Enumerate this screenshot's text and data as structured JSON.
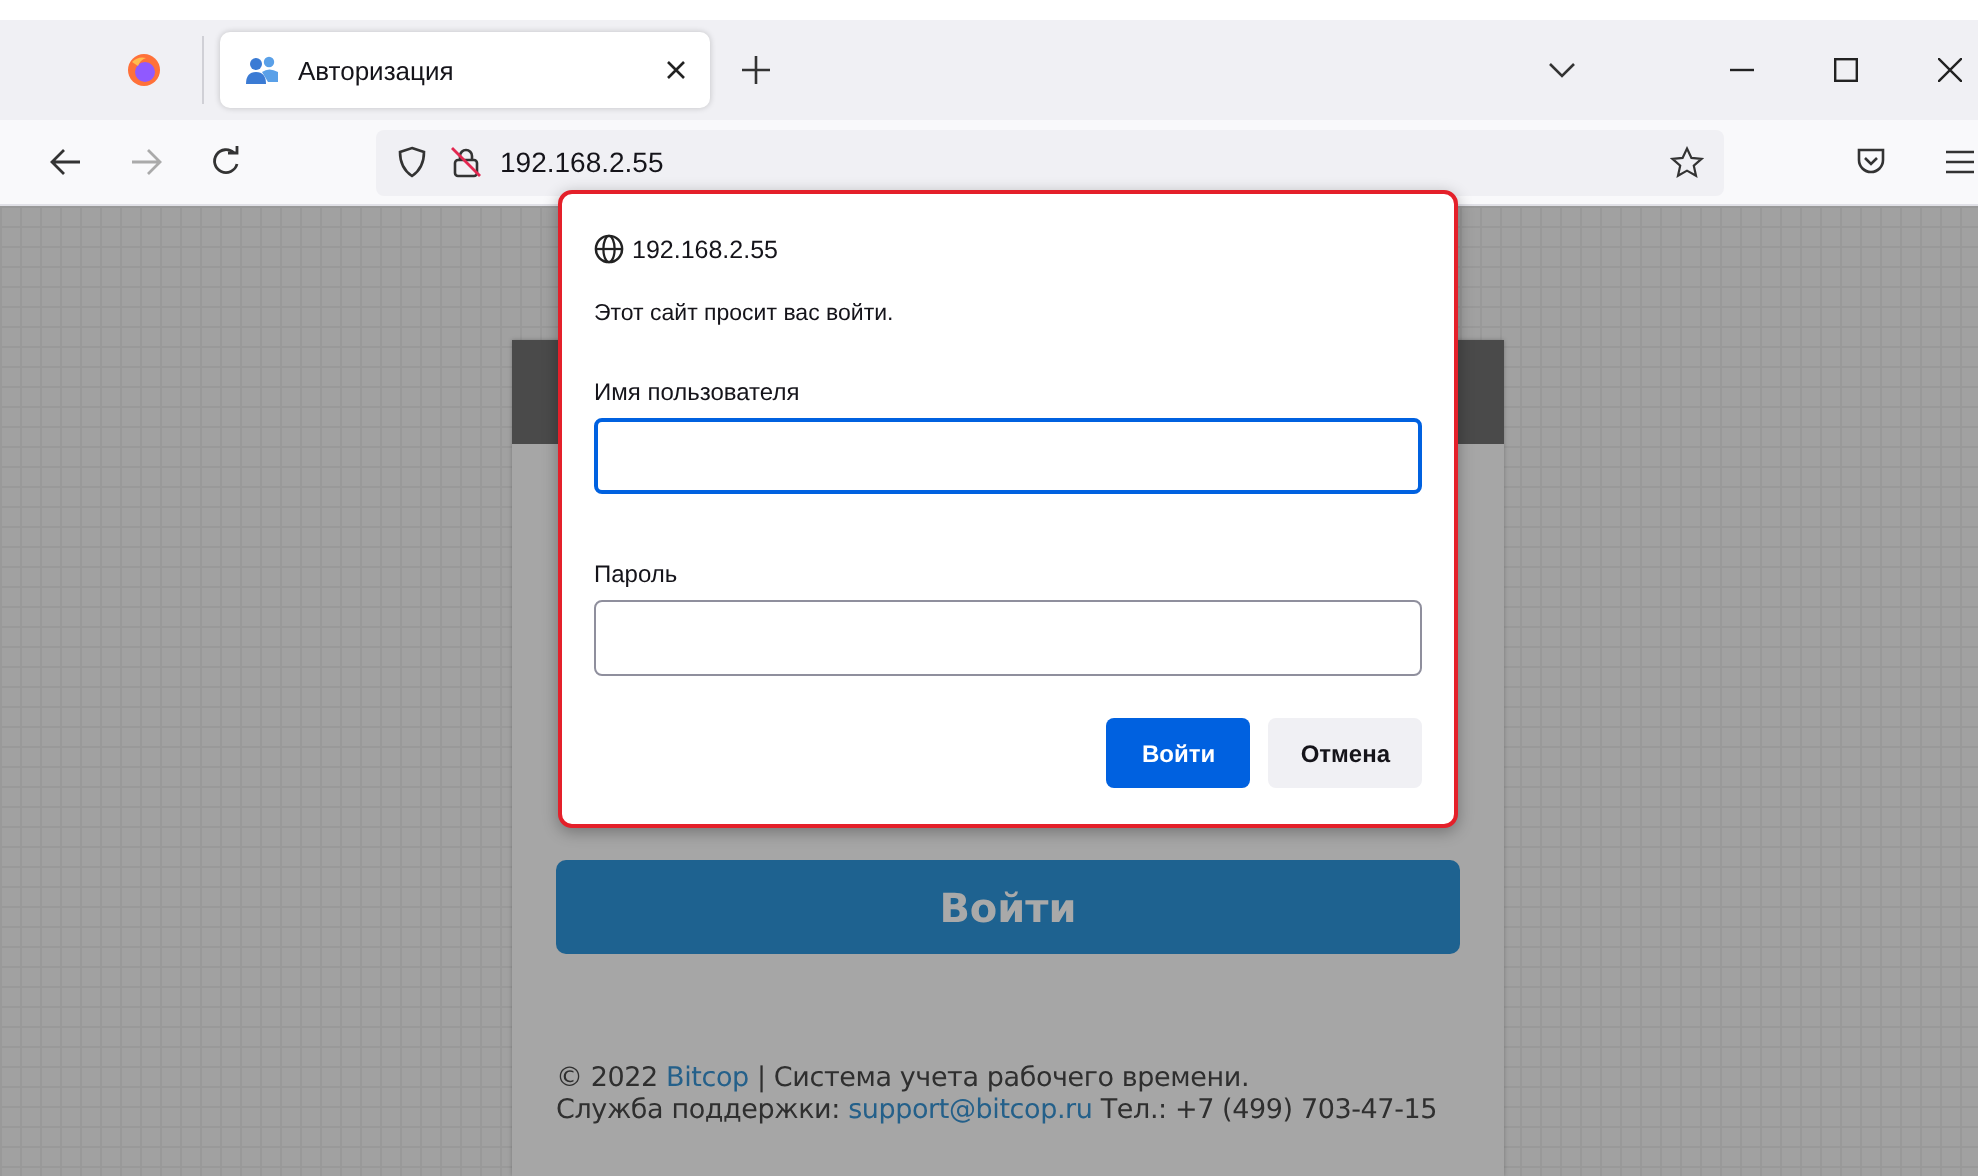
{
  "browser": {
    "tab": {
      "title": "Авторизация",
      "selected": true
    },
    "url": "192.168.2.55"
  },
  "page": {
    "login_button": "Войти",
    "footer": [
      {
        "before": "© 2022 ",
        "link": "Bitcop",
        "after": " | Система учета рабочего времени."
      },
      {
        "before": "Служба поддержки: ",
        "link": "support@bitcop.ru",
        "after": " Тел.: +7 (499) 703-47-15"
      }
    ]
  },
  "dialog": {
    "host": "192.168.2.55",
    "message": "Этот сайт просит вас войти.",
    "fields": [
      {
        "label": "Имя пользователя",
        "focused": true
      },
      {
        "label": "Пароль",
        "focused": false
      }
    ],
    "buttons": [
      {
        "label": "Войти",
        "primary": true
      },
      {
        "label": "Отмена",
        "primary": false
      }
    ]
  }
}
